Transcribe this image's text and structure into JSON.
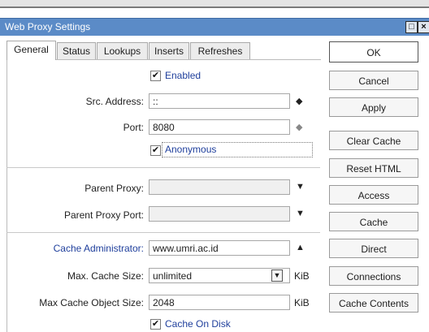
{
  "window": {
    "title": "Web Proxy Settings",
    "restore_glyph": "□",
    "close_glyph": "×"
  },
  "tabs": [
    {
      "label": "General",
      "active": true
    },
    {
      "label": "Status",
      "active": false
    },
    {
      "label": "Lookups",
      "active": false
    },
    {
      "label": "Inserts",
      "active": false
    },
    {
      "label": "Refreshes",
      "active": false
    }
  ],
  "form": {
    "enabled": {
      "label": "Enabled",
      "checked": true
    },
    "src_address": {
      "label": "Src. Address:",
      "value": "::"
    },
    "port": {
      "label": "Port:",
      "value": "8080"
    },
    "anonymous": {
      "label": "Anonymous",
      "checked": true
    },
    "parent_proxy": {
      "label": "Parent Proxy:",
      "value": ""
    },
    "parent_proxy_port": {
      "label": "Parent Proxy Port:",
      "value": ""
    },
    "cache_administrator": {
      "label": "Cache Administrator:",
      "value": "www.umri.ac.id"
    },
    "max_cache_size": {
      "label": "Max. Cache Size:",
      "value": "unlimited",
      "unit": "KiB"
    },
    "max_cache_object_size": {
      "label": "Max Cache Object Size:",
      "value": "2048",
      "unit": "KiB"
    },
    "cache_on_disk": {
      "label": "Cache On Disk",
      "checked": true
    }
  },
  "buttons": {
    "ok": "OK",
    "cancel": "Cancel",
    "apply": "Apply",
    "clear_cache": "Clear Cache",
    "reset_html": "Reset HTML",
    "access": "Access",
    "cache": "Cache",
    "direct": "Direct",
    "connections": "Connections",
    "cache_contents": "Cache Contents"
  },
  "glyphs": {
    "check": "✔",
    "updown": "◆",
    "down": "▼",
    "up": "▲",
    "spin_down": "▼"
  },
  "colors": {
    "titlebar": "#5b8bc7",
    "blue_label": "#1f3f9c"
  }
}
